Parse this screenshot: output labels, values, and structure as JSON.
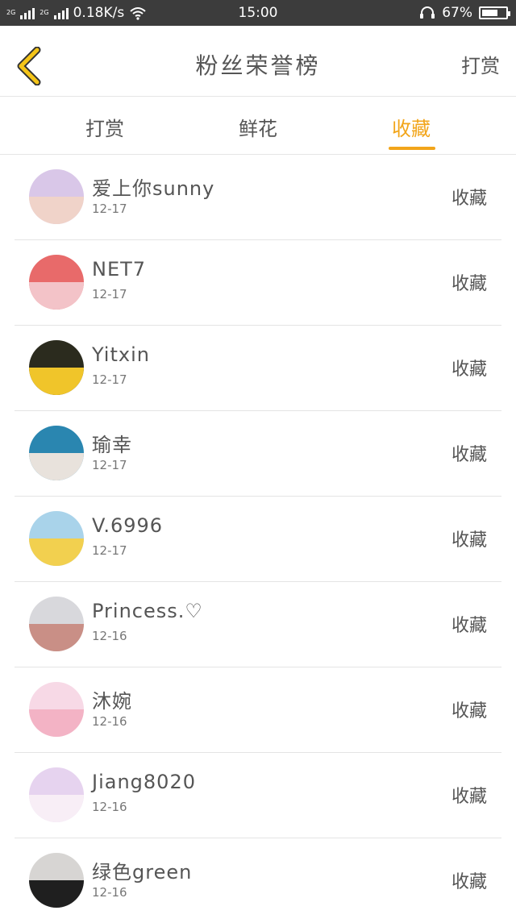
{
  "status_bar": {
    "net_left": "2G",
    "net_right": "2G",
    "speed": "0.18K/s",
    "time": "15:00",
    "battery": "67%",
    "battery_level": 0.67
  },
  "header": {
    "title": "粉丝荣誉榜",
    "right_label": "打赏"
  },
  "tabs": [
    {
      "label": "打赏"
    },
    {
      "label": "鲜花"
    },
    {
      "label": "收藏",
      "active": true
    }
  ],
  "colors": {
    "accent": "#f2a51a",
    "back_arrow": "#f5c518",
    "status_bar_bg": "#3c3c3c"
  },
  "items": [
    {
      "name": "爱上你sunny",
      "date": "12-17",
      "action": "收藏",
      "avatar_colors": [
        "#d9c7e8",
        "#f0d3c9"
      ]
    },
    {
      "name": "NET7",
      "date": "12-17",
      "action": "收藏",
      "avatar_colors": [
        "#e86a6a",
        "#f3c3c8"
      ]
    },
    {
      "name": "Yitxin",
      "date": "12-17",
      "action": "收藏",
      "avatar_colors": [
        "#2b2b1e",
        "#f0c52a"
      ]
    },
    {
      "name": "瑜幸",
      "date": "12-17",
      "action": "收藏",
      "avatar_colors": [
        "#2a86b0",
        "#e8e2dc"
      ]
    },
    {
      "name": "V.6996",
      "date": "12-17",
      "action": "收藏",
      "avatar_colors": [
        "#a9d3ea",
        "#f2d04f"
      ]
    },
    {
      "name": "Princess.♡",
      "date": "12-16",
      "action": "收藏",
      "avatar_colors": [
        "#d8d8dc",
        "#c98f86"
      ]
    },
    {
      "name": "沐婉",
      "date": "12-16",
      "action": "收藏",
      "avatar_colors": [
        "#f7d9e6",
        "#f3b3c5"
      ]
    },
    {
      "name": "Jiang8020",
      "date": "12-16",
      "action": "收藏",
      "avatar_colors": [
        "#e6d3ef",
        "#f8eef6"
      ]
    },
    {
      "name": "绿色green",
      "date": "12-16",
      "action": "收藏",
      "avatar_colors": [
        "#d7d5d3",
        "#1f1f1f"
      ]
    }
  ]
}
